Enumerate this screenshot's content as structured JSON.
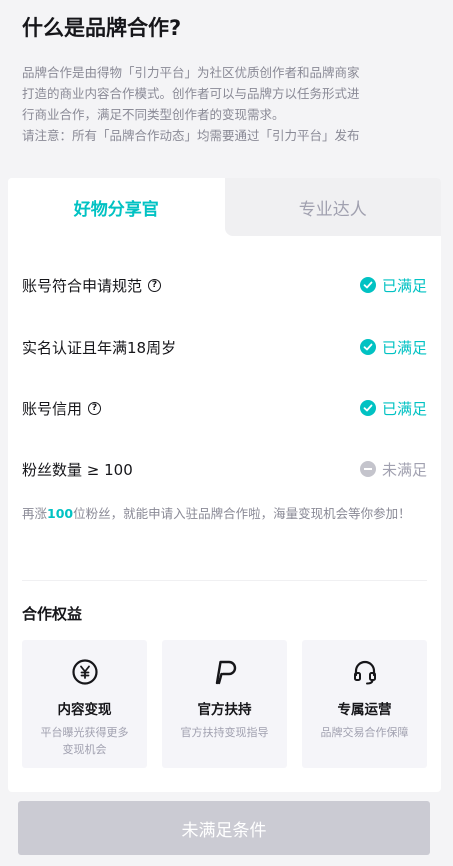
{
  "page": {
    "title": "什么是品牌合作?",
    "intro_lines": [
      "品牌合作是由得物「引力平台」为社区优质创作者和品牌商家",
      "打造的商业内容合作模式。创作者可以与品牌方以任务形式进",
      "行商业合作，满足不同类型创作者的变现需求。",
      "请注意：所有「品牌合作动态」均需要通过「引力平台」发布"
    ]
  },
  "tabs": [
    {
      "label": "好物分享官",
      "active": true
    },
    {
      "label": "专业达人",
      "active": false
    }
  ],
  "requirements": [
    {
      "label": "账号符合申请规范",
      "help": true,
      "status": "已满足",
      "met": true
    },
    {
      "label": "实名认证且年满18周岁",
      "help": false,
      "status": "已满足",
      "met": true
    },
    {
      "label": "账号信用",
      "help": true,
      "status": "已满足",
      "met": true
    },
    {
      "label": "粉丝数量 ≥ 100",
      "help": false,
      "status": "未满足",
      "met": false
    }
  ],
  "tip": {
    "prefix": "再涨",
    "highlight": "100",
    "suffix": "位粉丝，就能申请入驻品牌合作啦，海量变现机会等你参加！"
  },
  "benefits": {
    "title": "合作权益",
    "items": [
      {
        "icon": "yen-coin-icon",
        "name": "内容变现",
        "desc": "平台曝光获得更多变现机会"
      },
      {
        "icon": "flag-p-icon",
        "name": "官方扶持",
        "desc": "官方扶持变现指导"
      },
      {
        "icon": "headset-icon",
        "name": "专属运营",
        "desc": "品牌交易合作保障"
      }
    ]
  },
  "cta": {
    "label": "未满足条件"
  },
  "colors": {
    "accent": "#01c2c3",
    "muted": "#a1a1b0",
    "disabled": "#cbcbd3"
  }
}
